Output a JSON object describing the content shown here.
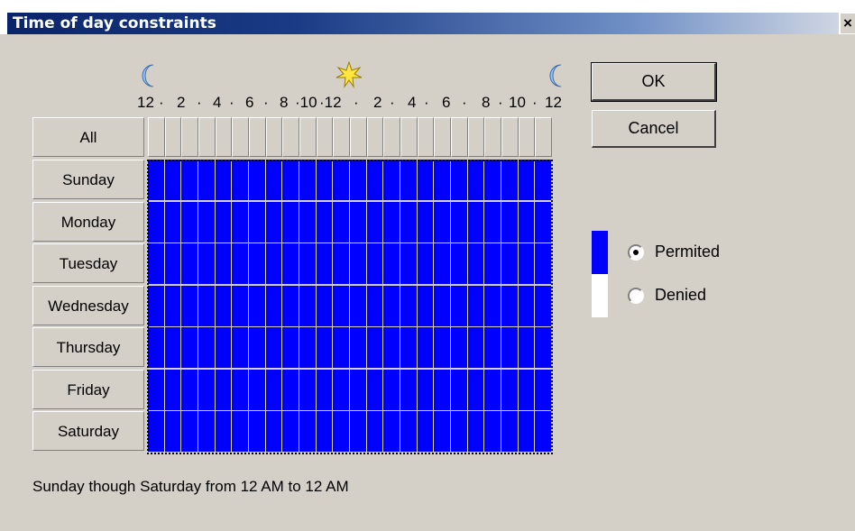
{
  "window": {
    "title": "Time of day constraints",
    "close_glyph": "×"
  },
  "hour_labels": [
    "12",
    "·",
    "2",
    "·",
    "4",
    "·",
    "6",
    "·",
    "8",
    "·10",
    "·12",
    "·",
    "2",
    "·",
    "4",
    "·",
    "6",
    "·",
    "8",
    "·",
    "10",
    "·",
    "12"
  ],
  "header_icons": [
    "moon-icon",
    "sun-icon",
    "moon-icon"
  ],
  "all_label": "All",
  "days": [
    "Sunday",
    "Monday",
    "Tuesday",
    "Wednesday",
    "Thursday",
    "Friday",
    "Saturday"
  ],
  "hours_per_day": 24,
  "permitted_fraction": 1.0,
  "buttons": {
    "ok": "OK",
    "cancel": "Cancel"
  },
  "legend": {
    "permitted": {
      "label": "Permited",
      "color": "#0000ff",
      "selected": true
    },
    "denied": {
      "label": "Denied",
      "color": "#ffffff",
      "selected": false
    }
  },
  "status_text": "Sunday though Saturday from 12 AM to 12 AM",
  "colors": {
    "accent": "#0000ff",
    "title_bar": "#0a246a",
    "background": "#d4d0c8"
  }
}
